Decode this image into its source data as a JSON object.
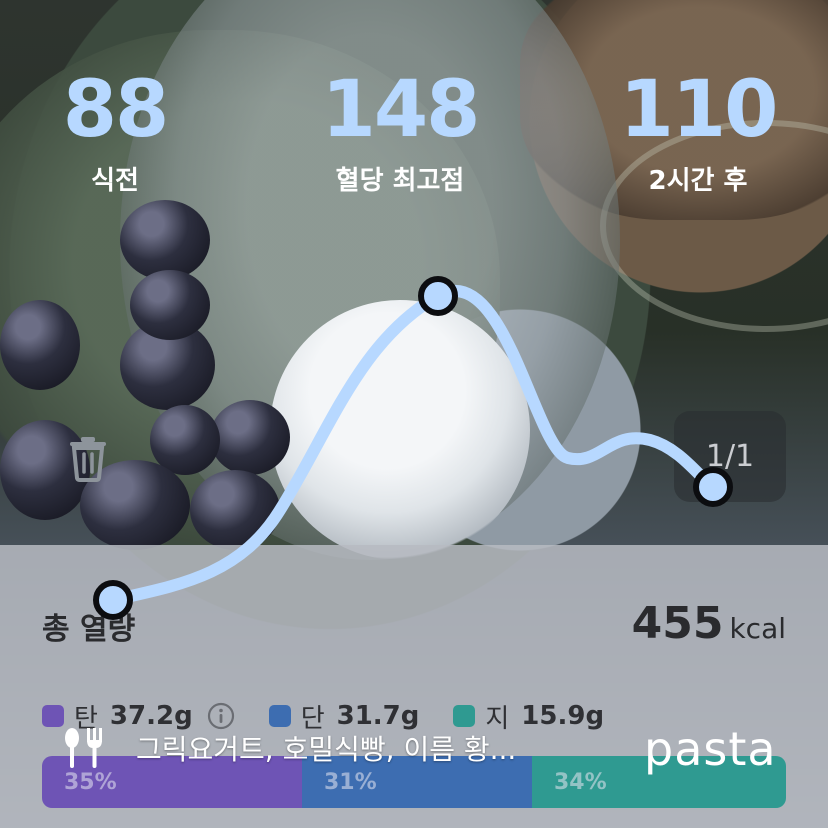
{
  "stats": [
    {
      "value": "88",
      "label": "식전"
    },
    {
      "value": "148",
      "label": "혈당 최고점"
    },
    {
      "value": "110",
      "label": "2시간 후"
    }
  ],
  "pager": {
    "text": "1/1"
  },
  "calories": {
    "title": "총 열량",
    "value": "455",
    "unit": "kcal"
  },
  "macros": [
    {
      "name": "탄",
      "value": "37.2g",
      "color": "#6e54b5"
    },
    {
      "name": "단",
      "value": "31.7g",
      "color": "#3d6db1"
    },
    {
      "name": "지",
      "value": "15.9g",
      "color": "#2f9a91"
    }
  ],
  "ratio_bar": [
    {
      "label": "35%",
      "percent": 35,
      "color": "#6e54b5"
    },
    {
      "label": "31%",
      "percent": 31,
      "color": "#3d6db1"
    },
    {
      "label": "34%",
      "percent": 34,
      "color": "#2f9a91"
    }
  ],
  "meal": {
    "text": "그릭요거트, 호밀식빵, 이름 황..."
  },
  "brand": {
    "logo": "pasta"
  },
  "colors": {
    "accent": "#b7d8ff",
    "curve": "#b7d8ff"
  },
  "glucose_curve": {
    "start": 88,
    "peak": 148,
    "end": 110
  }
}
